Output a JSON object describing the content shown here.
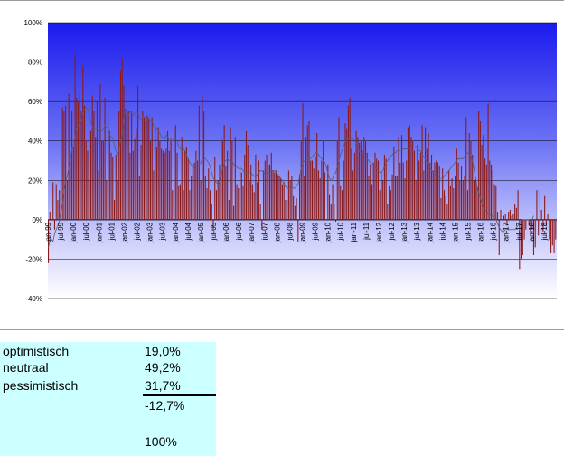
{
  "chart_data": {
    "type": "bar",
    "ylim": [
      -40,
      100
    ],
    "yticks": [
      "100%",
      "80%",
      "60%",
      "40%",
      "20%",
      "0%",
      "-20%",
      "-40%"
    ],
    "ytick_values": [
      100,
      80,
      60,
      40,
      20,
      0,
      -20,
      -40
    ],
    "xtick_labels": [
      "jan-99",
      "jul-99",
      "jan-00",
      "jul-00",
      "jan-01",
      "jul-01",
      "jan-02",
      "jul-02",
      "jan-03",
      "jul-03",
      "jan-04",
      "jul-04",
      "jan-05",
      "jul-05",
      "jan-06",
      "jul-06",
      "jan-07",
      "jul-07",
      "jan-08",
      "jul-08",
      "jan-09",
      "jul-09",
      "jan-10",
      "jul-10",
      "jan-11",
      "jul-11",
      "jan-12",
      "jul-12",
      "jan-13",
      "jul-13",
      "jan-14",
      "jul-14",
      "jan-15",
      "jul-15",
      "jan-16",
      "jul-16",
      "jan-17",
      "jul-17",
      "jan-18",
      "jul-18"
    ],
    "values": [
      -22,
      4,
      0,
      19,
      -5,
      18,
      10,
      15,
      20,
      57,
      55,
      58,
      20,
      64,
      30,
      55,
      37,
      84,
      62,
      60,
      64,
      55,
      78,
      58,
      40,
      35,
      20,
      45,
      63,
      55,
      42,
      60,
      25,
      69,
      40,
      40,
      62,
      20,
      55,
      45,
      34,
      32,
      10,
      33,
      20,
      55,
      76,
      82,
      68,
      56,
      53,
      55,
      34,
      55,
      35,
      41,
      46,
      68,
      22,
      38,
      55,
      52,
      50,
      53,
      51,
      40,
      52,
      25,
      47,
      37,
      47,
      40,
      36,
      35,
      34,
      36,
      45,
      35,
      41,
      15,
      47,
      48,
      34,
      17,
      18,
      42,
      15,
      35,
      37,
      31,
      15,
      22,
      28,
      29,
      35,
      30,
      58,
      20,
      63,
      55,
      22,
      16,
      26,
      15,
      8,
      -5,
      32,
      15,
      20,
      28,
      42,
      40,
      48,
      27,
      35,
      10,
      47,
      40,
      7,
      42,
      18,
      16,
      27,
      24,
      17,
      33,
      45,
      38,
      20,
      28,
      18,
      14,
      33,
      19,
      30,
      8,
      -5,
      25,
      30,
      33,
      28,
      28,
      34,
      25,
      24,
      25,
      22,
      22,
      21,
      18,
      19,
      10,
      10,
      25,
      20,
      22,
      12,
      7,
      11,
      -11,
      23,
      40,
      59,
      22,
      42,
      48,
      50,
      30,
      30,
      26,
      32,
      44,
      25,
      21,
      30,
      40,
      24,
      0,
      28,
      13,
      8,
      18,
      8,
      -1,
      40,
      52,
      17,
      15,
      30,
      49,
      46,
      58,
      62,
      36,
      25,
      34,
      45,
      42,
      39,
      40,
      35,
      42,
      40,
      34,
      22,
      28,
      18,
      29,
      34,
      31,
      30,
      15,
      24,
      20,
      33,
      31,
      8,
      17,
      15,
      23,
      37,
      22,
      22,
      42,
      29,
      43,
      29,
      21,
      30,
      47,
      48,
      42,
      40,
      35,
      20,
      38,
      30,
      34,
      48,
      25,
      47,
      36,
      44,
      29,
      33,
      25,
      29,
      30,
      29,
      27,
      11,
      26,
      15,
      12,
      8,
      25,
      17,
      21,
      16,
      22,
      36,
      29,
      20,
      27,
      20,
      22,
      52,
      15,
      44,
      40,
      33,
      20,
      21,
      17,
      55,
      50,
      38,
      43,
      31,
      28,
      59,
      30,
      28,
      25,
      18,
      17,
      4,
      -18,
      5,
      0,
      2,
      3,
      -3,
      4,
      5,
      2,
      3,
      8,
      6,
      15,
      -25,
      -20,
      -18,
      -10,
      -5,
      0,
      -3,
      -8,
      -5,
      -18,
      -14,
      15,
      -8,
      15,
      5,
      -6,
      12,
      -3,
      3,
      -10,
      -17,
      -13,
      -17,
      -10
    ],
    "trend": [
      -14,
      -11,
      -10,
      -11,
      -7,
      -5,
      -3,
      -1,
      4,
      9,
      14,
      19,
      22,
      26,
      30,
      36,
      38,
      42,
      46,
      48,
      49,
      50,
      54,
      56,
      57,
      56,
      53,
      50,
      47,
      46,
      46,
      46,
      45,
      45,
      45,
      46,
      48,
      47,
      46,
      43,
      42,
      41,
      38,
      35,
      33,
      35,
      40,
      44,
      50,
      55,
      54,
      53,
      55,
      54,
      53,
      54,
      54,
      54,
      52,
      51,
      52,
      52,
      52,
      53,
      51,
      50,
      50,
      48,
      47,
      46,
      45,
      44,
      42,
      42,
      41,
      43,
      42,
      40,
      40,
      40,
      41,
      41,
      40,
      37,
      36,
      36,
      36,
      35,
      33,
      31,
      29,
      28,
      27,
      26,
      27,
      27,
      28,
      29,
      31,
      32,
      31,
      30,
      29,
      27,
      24,
      21,
      20,
      19,
      18,
      19,
      22,
      26,
      29,
      30,
      31,
      30,
      30,
      30,
      28,
      27,
      27,
      26,
      26,
      26,
      25,
      24,
      24,
      24,
      24,
      24,
      23,
      22,
      22,
      23,
      24,
      25,
      25,
      24,
      23,
      23,
      24,
      24,
      25,
      25,
      25,
      24,
      23,
      22,
      21,
      20,
      18,
      17,
      16,
      16,
      17,
      17,
      16,
      16,
      17,
      18,
      22,
      26,
      29,
      30,
      30,
      31,
      31,
      31,
      32,
      33,
      34,
      34,
      33,
      32,
      31,
      30,
      29,
      27,
      24,
      21,
      20,
      21,
      23,
      24,
      27,
      30,
      33,
      35,
      37,
      40,
      41,
      41,
      42,
      42,
      41,
      40,
      39,
      37,
      35,
      34,
      33,
      32,
      32,
      31,
      30,
      29,
      28,
      28,
      27,
      26,
      25,
      24,
      24,
      25,
      27,
      29,
      30,
      31,
      32,
      33,
      34,
      34,
      35,
      35,
      35,
      35,
      36,
      36,
      36,
      36,
      36,
      37,
      37,
      37,
      37,
      36,
      35,
      35,
      33,
      32,
      31,
      29,
      28,
      27,
      25,
      24,
      23,
      22,
      22,
      21,
      21,
      21,
      22,
      23,
      24,
      25,
      26,
      27,
      28,
      29,
      30,
      31,
      31,
      31,
      31,
      32,
      33,
      34,
      34,
      33,
      30,
      26,
      21,
      17,
      14,
      11,
      8,
      6,
      5,
      4,
      3,
      3,
      2,
      2,
      1,
      0,
      -2,
      -4,
      -5,
      -6,
      -6,
      -5,
      -5,
      -5,
      -5,
      -5,
      -5,
      -5,
      -4,
      -3,
      -2,
      -1,
      0,
      0,
      0,
      0,
      0,
      -1,
      0,
      2
    ]
  },
  "table": {
    "rows": [
      {
        "label": "optimistisch",
        "value": "19,0%"
      },
      {
        "label": "neutraal",
        "value": "49,2%"
      },
      {
        "label": "pessimistisch",
        "value": "31,7%"
      },
      {
        "label": "",
        "value": "-12,7%"
      },
      {
        "label": "",
        "value": ""
      },
      {
        "label": "",
        "value": "100%"
      }
    ]
  }
}
